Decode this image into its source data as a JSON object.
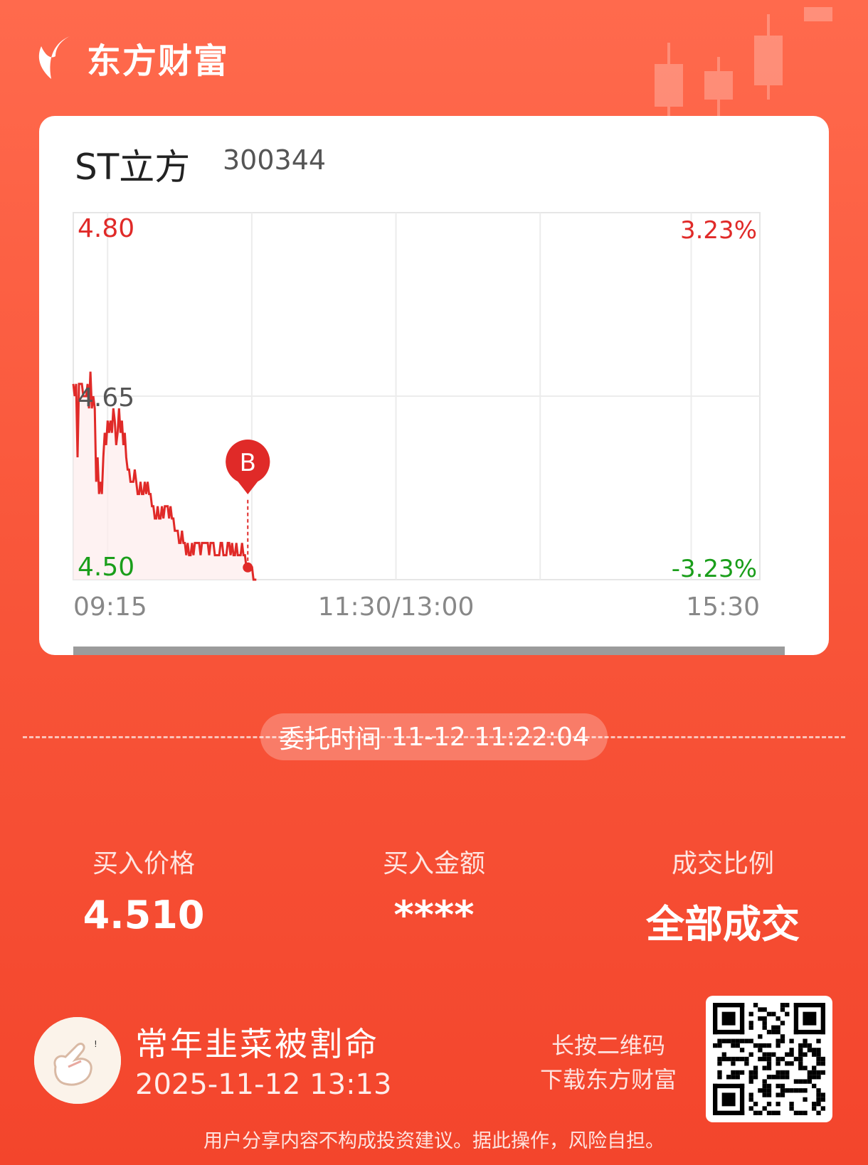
{
  "brand": {
    "name": "东方财富",
    "icon": "eastmoney-logo-icon"
  },
  "stock": {
    "name": "ST立方",
    "code": "300344"
  },
  "chart_data": {
    "type": "line",
    "y_left_ticks": [
      "4.80",
      "4.65",
      "4.50"
    ],
    "y_right_ticks": [
      "3.23%",
      "-3.23%"
    ],
    "x_ticks": [
      "09:15",
      "11:30/13:00",
      "15:30"
    ],
    "ylim": [
      4.5,
      4.8
    ],
    "grid": true,
    "colors": {
      "line": "#e02a28",
      "up": "#e02a28",
      "down": "#1a9e1a",
      "neutral": "#555555"
    },
    "series": [
      {
        "x": [
          0,
          1,
          2,
          3,
          4,
          5,
          6,
          7,
          8,
          9,
          10,
          11,
          12,
          13,
          14,
          15,
          16,
          17,
          18,
          19,
          20,
          21,
          22,
          23,
          24,
          25,
          26,
          27,
          28,
          29,
          30,
          31,
          32,
          33,
          34,
          35,
          36,
          37,
          38,
          39,
          40,
          41,
          42,
          43,
          44,
          45,
          46,
          47,
          48,
          49,
          50,
          51,
          52,
          53,
          54,
          55,
          56,
          57,
          58,
          59,
          60,
          61,
          62,
          63,
          64,
          65,
          66,
          67,
          68,
          69,
          70,
          71,
          72,
          73,
          74,
          75,
          76,
          77,
          78,
          79,
          80,
          81,
          82,
          83,
          84,
          85,
          86,
          87,
          88,
          89,
          90,
          91,
          92,
          93,
          94,
          95,
          96,
          97,
          98,
          99,
          100,
          101,
          102,
          103,
          104,
          105,
          106,
          107,
          108,
          109,
          110,
          111,
          112,
          113,
          114,
          115,
          116,
          117,
          118,
          119,
          120,
          121,
          122,
          123,
          124,
          125,
          126,
          127,
          128
        ],
        "values": [
          4.66,
          4.65,
          4.66,
          4.6,
          4.66,
          4.66,
          4.66,
          4.65,
          4.65,
          4.65,
          4.66,
          4.64,
          4.67,
          4.64,
          4.65,
          4.64,
          4.58,
          4.6,
          4.57,
          4.58,
          4.57,
          4.6,
          4.62,
          4.61,
          4.63,
          4.62,
          4.63,
          4.62,
          4.64,
          4.63,
          4.61,
          4.62,
          4.64,
          4.62,
          4.63,
          4.61,
          4.62,
          4.6,
          4.59,
          4.59,
          4.58,
          4.58,
          4.58,
          4.59,
          4.58,
          4.57,
          4.57,
          4.58,
          4.57,
          4.57,
          4.58,
          4.57,
          4.58,
          4.57,
          4.57,
          4.56,
          4.56,
          4.55,
          4.55,
          4.56,
          4.55,
          4.55,
          4.56,
          4.55,
          4.56,
          4.56,
          4.56,
          4.55,
          4.56,
          4.55,
          4.55,
          4.54,
          4.54,
          4.54,
          4.53,
          4.53,
          4.54,
          4.53,
          4.53,
          4.52,
          4.53,
          4.52,
          4.52,
          4.53,
          4.52,
          4.53,
          4.53,
          4.53,
          4.53,
          4.52,
          4.53,
          4.53,
          4.53,
          4.53,
          4.53,
          4.52,
          4.53,
          4.53,
          4.53,
          4.52,
          4.52,
          4.52,
          4.52,
          4.53,
          4.53,
          4.52,
          4.52,
          4.52,
          4.53,
          4.53,
          4.52,
          4.53,
          4.52,
          4.52,
          4.53,
          4.52,
          4.52,
          4.52,
          4.53,
          4.52,
          4.52,
          4.51,
          4.51,
          4.51,
          4.51,
          4.51,
          4.5,
          4.5,
          4.5
        ]
      }
    ],
    "marker": {
      "label": "B",
      "price": 4.51,
      "time": "11:22"
    }
  },
  "order": {
    "label": "委托时间",
    "time": "11-12 11:22:04"
  },
  "stats": [
    {
      "label": "买入价格",
      "value": "4.510"
    },
    {
      "label": "买入金额",
      "value": "****"
    },
    {
      "label": "成交比例",
      "value": "全部成交"
    }
  ],
  "user": {
    "name": "常年韭菜被割命",
    "time": "2025-11-12 13:13",
    "avatar_icon": "hand-gesture-avatar-icon"
  },
  "qr": {
    "hint_line1": "长按二维码",
    "hint_line2": "下载东方财富",
    "icon": "qr-code-icon"
  },
  "disclaimer": "用户分享内容不构成投资建议。据此操作，风险自担。"
}
